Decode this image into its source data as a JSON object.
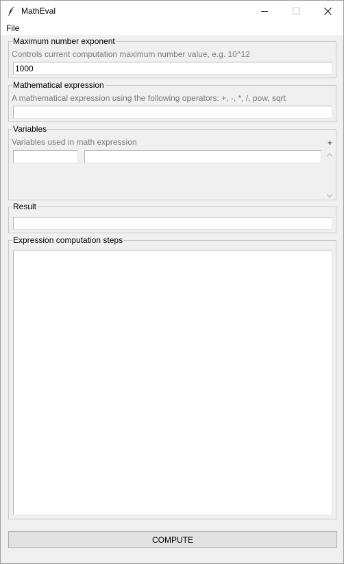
{
  "window": {
    "title": "MathEval",
    "icon": "feather-icon"
  },
  "menu": {
    "file_label": "File"
  },
  "exponent": {
    "title": "Maximum number exponent",
    "hint": "Controls current computation maximum number value, e.g. 10^12",
    "value": "1000"
  },
  "expression": {
    "title": "Mathematical expression",
    "hint": "A mathematical expression using the following operators: +, -, *, /, pow, sqrt",
    "value": ""
  },
  "variables": {
    "title": "Variables",
    "hint": "Variables used in math expression",
    "add_label": "+",
    "name_value": "",
    "value_value": ""
  },
  "result": {
    "title": "Result",
    "value": ""
  },
  "steps": {
    "title": "Expression computation steps",
    "text": ""
  },
  "compute_label": "COMPUTE"
}
